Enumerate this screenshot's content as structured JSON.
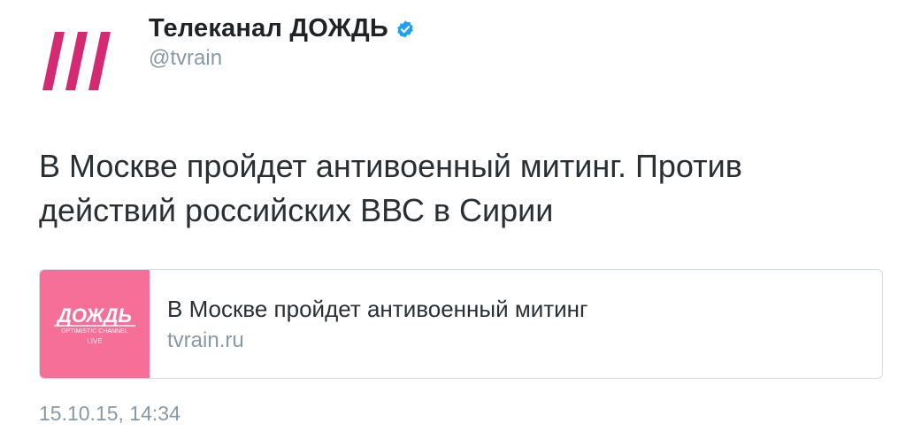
{
  "author": {
    "display_name": "Телеканал ДОЖДЬ",
    "handle": "@tvrain",
    "verified": true,
    "brand_color": "#d42a72"
  },
  "tweet": {
    "text": "В Москве пройдет антивоенный митинг. Против действий российских ВВС в Сирии",
    "timestamp": "15.10.15, 14:34"
  },
  "card": {
    "title": "В Москве пройдет антивоенный митинг",
    "domain": "tvrain.ru",
    "thumb_bg": "#f56f99",
    "logo": {
      "main": "ДОЖДЬ",
      "tagline": "OPTIMISTIC CHANNEL",
      "live": "LIVE"
    }
  },
  "colors": {
    "verified_badge": "#1da1f2",
    "secondary_text": "#8899a6"
  }
}
